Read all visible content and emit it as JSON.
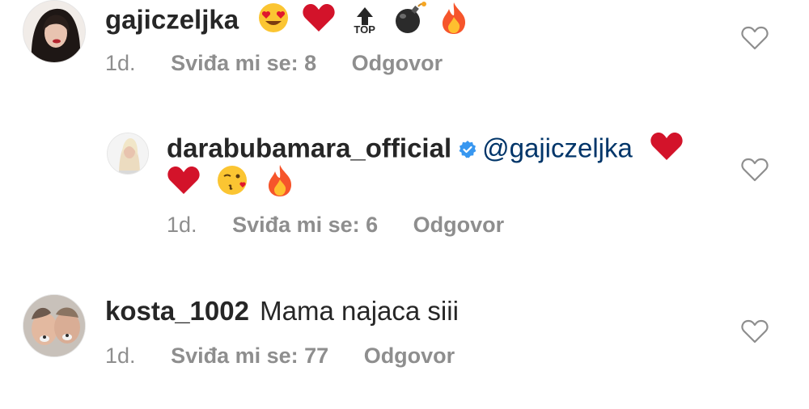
{
  "comments": [
    {
      "username": "gajiczeljka",
      "text": "",
      "emojis": [
        "smiling-face-with-heart-eyes",
        "red-heart",
        "top-arrow",
        "bomb",
        "fire"
      ],
      "time": "1d.",
      "likes": "Sviđa mi se: 8",
      "reply": "Odgovor"
    },
    {
      "username": "darabubamara_official",
      "verified": true,
      "mention": "@gajiczeljka",
      "emojis_line1": [
        "red-heart"
      ],
      "emojis_line2": [
        "red-heart",
        "face-blowing-a-kiss",
        "fire"
      ],
      "time": "1d.",
      "likes": "Sviđa mi se: 6",
      "reply": "Odgovor"
    },
    {
      "username": "kosta_1002",
      "text": "Mama najaca siii",
      "time": "1d.",
      "likes": "Sviđa mi se: 77",
      "reply": "Odgovor"
    }
  ],
  "top_emoji_label": "TOP",
  "colors": {
    "text": "#262626",
    "meta": "#8e8e8e",
    "mention": "#003569",
    "verified": "#3897f0",
    "heart": "#e0182d"
  }
}
